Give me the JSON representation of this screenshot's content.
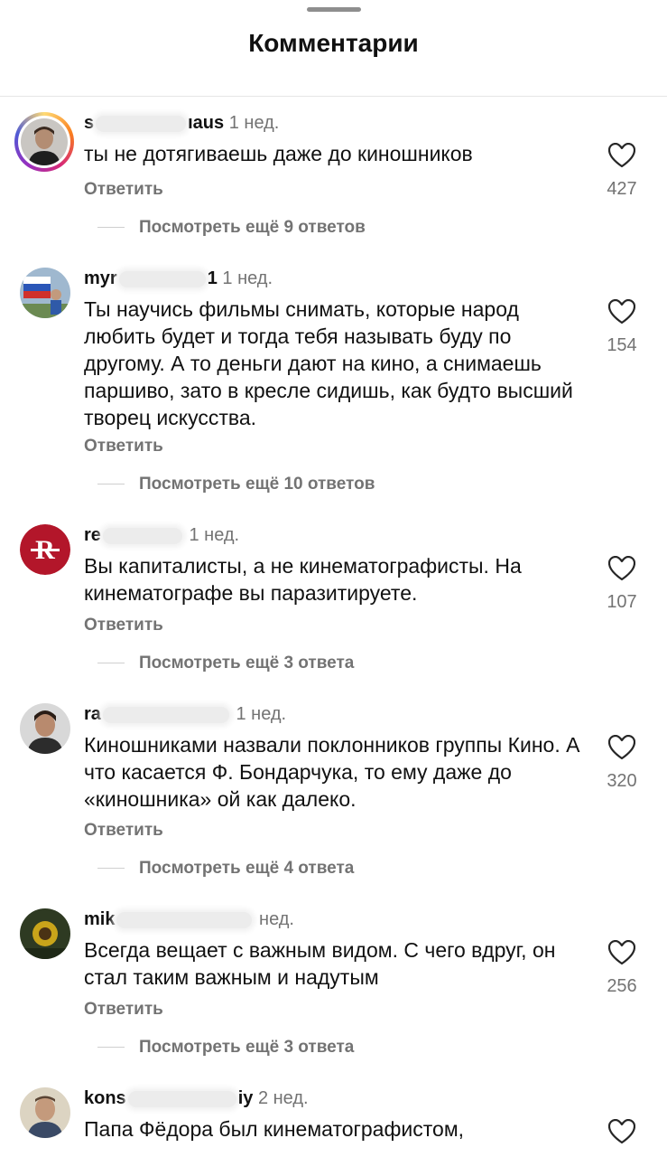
{
  "header": {
    "title": "Комментарии"
  },
  "comments": [
    {
      "user_prefix": "s",
      "user_suffix": "ıaus",
      "time": "1 нед.",
      "text": "ты не дотягиваешь даже до киношников",
      "reply_label": "Ответить",
      "more_label": "Посмотреть ещё 9 ответов",
      "likes": "427",
      "avatar_icon": "story-ring-avatar"
    },
    {
      "user_prefix": "myr",
      "user_suffix": "1",
      "time": "1 нед.",
      "text": "Ты научись фильмы снимать, которые народ любить будет и тогда тебя называть буду по другому. А то деньги дают на кино, а снимаешь паршиво, зато в кресле сидишь, как будто высший творец искусства.",
      "reply_label": "Ответить",
      "more_label": "Посмотреть ещё 10 ответов",
      "likes": "154",
      "avatar_icon": "flag-avatar"
    },
    {
      "user_prefix": "re",
      "user_suffix": "",
      "time": "1 нед.",
      "text": "Вы капиталисты, а не кинематографисты. На кинематографе вы паразитируете.",
      "reply_label": "Ответить",
      "more_label": "Посмотреть ещё 3 ответа",
      "likes": "107",
      "avatar_icon": "r-logo-avatar"
    },
    {
      "user_prefix": "ra",
      "user_suffix": "",
      "time": "1 нед.",
      "text": "Киношниками назвали поклонников группы Кино. А что касается Ф. Бондарчука, то ему даже до «киношника» ой как далеко.",
      "reply_label": "Ответить",
      "more_label": "Посмотреть ещё 4 ответа",
      "likes": "320",
      "avatar_icon": "man-avatar"
    },
    {
      "user_prefix": "mik",
      "user_suffix": "",
      "time": "нед.",
      "text": "Всегда вещает с важным видом. С чего вдруг, он стал таким важным и надутым",
      "reply_label": "Ответить",
      "more_label": "Посмотреть ещё 3 ответа",
      "likes": "256",
      "avatar_icon": "sunflower-avatar"
    },
    {
      "user_prefix": "kons",
      "user_suffix": "iy",
      "time": "2 нед.",
      "text": "Папа Фёдора был кинематографистом,",
      "reply_label": "",
      "more_label": "",
      "likes": "",
      "avatar_icon": "man-avatar"
    }
  ],
  "colors": {
    "secondary_text": "#737373",
    "primary_text": "#111111",
    "heart_outline": "#262626"
  }
}
